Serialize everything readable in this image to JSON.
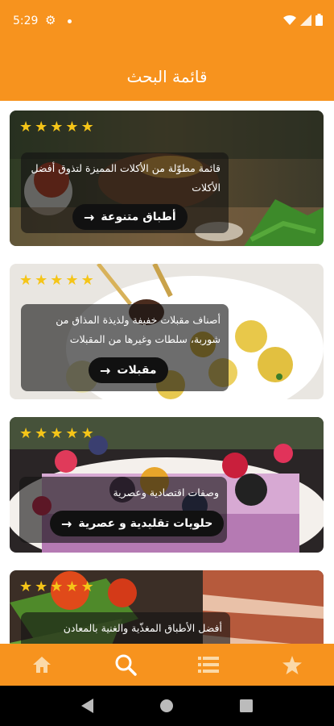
{
  "status_bar": {
    "time": "5:29"
  },
  "app_bar": {
    "title": "قائمة البحث"
  },
  "cards": [
    {
      "stars": [
        "★",
        "★",
        "★",
        "★",
        "★"
      ],
      "caption": "قائمة مطوّلة من الأكلات المميزة لتذوق أفضل الأكلات",
      "button_label": "أطباق متنوعة",
      "arrow": "→"
    },
    {
      "stars": [
        "★",
        "★",
        "★",
        "★",
        "★"
      ],
      "caption": "أصناف مقبلات خفيفة ولذيذة المذاق من شوربة، سلطات وغيرها من المقبلات",
      "button_label": "مقبلات",
      "arrow": "→"
    },
    {
      "stars": [
        "★",
        "★",
        "★",
        "★",
        "★"
      ],
      "caption": "وصفات اقتصادية وعصرية",
      "button_label": "حلويات تقليدية و عصرية",
      "arrow": "→"
    },
    {
      "stars": [
        "★",
        "★",
        "★",
        "★",
        "★"
      ],
      "caption": "أفضل الأطباق المغذّية والغنية بالمعادن"
    }
  ],
  "bottom_nav": {
    "items": [
      {
        "icon": "home-icon"
      },
      {
        "icon": "search-icon"
      },
      {
        "icon": "list-icon"
      },
      {
        "icon": "star-icon"
      }
    ],
    "active_index": 1
  },
  "colors": {
    "accent": "#f7931e",
    "star": "#f5c518",
    "nav_icon": "#fbd9a8",
    "nav_icon_active": "#ffffff"
  }
}
